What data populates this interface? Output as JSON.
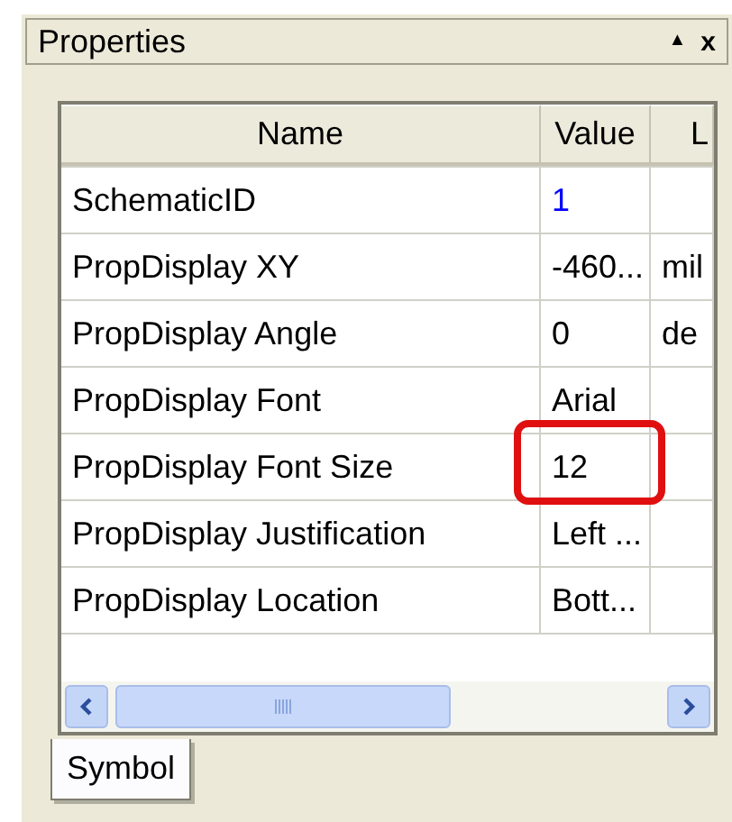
{
  "panel": {
    "title": "Properties",
    "pin_icon": "▲",
    "close_icon": "x"
  },
  "table": {
    "columns": [
      "Name",
      "Value",
      "L"
    ],
    "rows": [
      {
        "name": "SchematicID",
        "value": "1",
        "unit": "",
        "color": "#0000ff",
        "highlighted": false
      },
      {
        "name": "PropDisplay XY",
        "value": "-460...",
        "unit": "mil",
        "color": "#000000",
        "highlighted": false
      },
      {
        "name": "PropDisplay Angle",
        "value": "0",
        "unit": "de",
        "color": "#000000",
        "highlighted": false
      },
      {
        "name": "PropDisplay Font",
        "value": "Arial",
        "unit": "",
        "color": "#000000",
        "highlighted": false
      },
      {
        "name": "PropDisplay Font Size",
        "value": "12",
        "unit": "",
        "color": "#000000",
        "highlighted": true
      },
      {
        "name": "PropDisplay Justification",
        "value": "Left ...",
        "unit": "",
        "color": "#000000",
        "highlighted": false
      },
      {
        "name": "PropDisplay Location",
        "value": "Bott...",
        "unit": "",
        "color": "#000000",
        "highlighted": false
      }
    ]
  },
  "tabs": [
    {
      "label": "Symbol",
      "selected": true
    }
  ]
}
